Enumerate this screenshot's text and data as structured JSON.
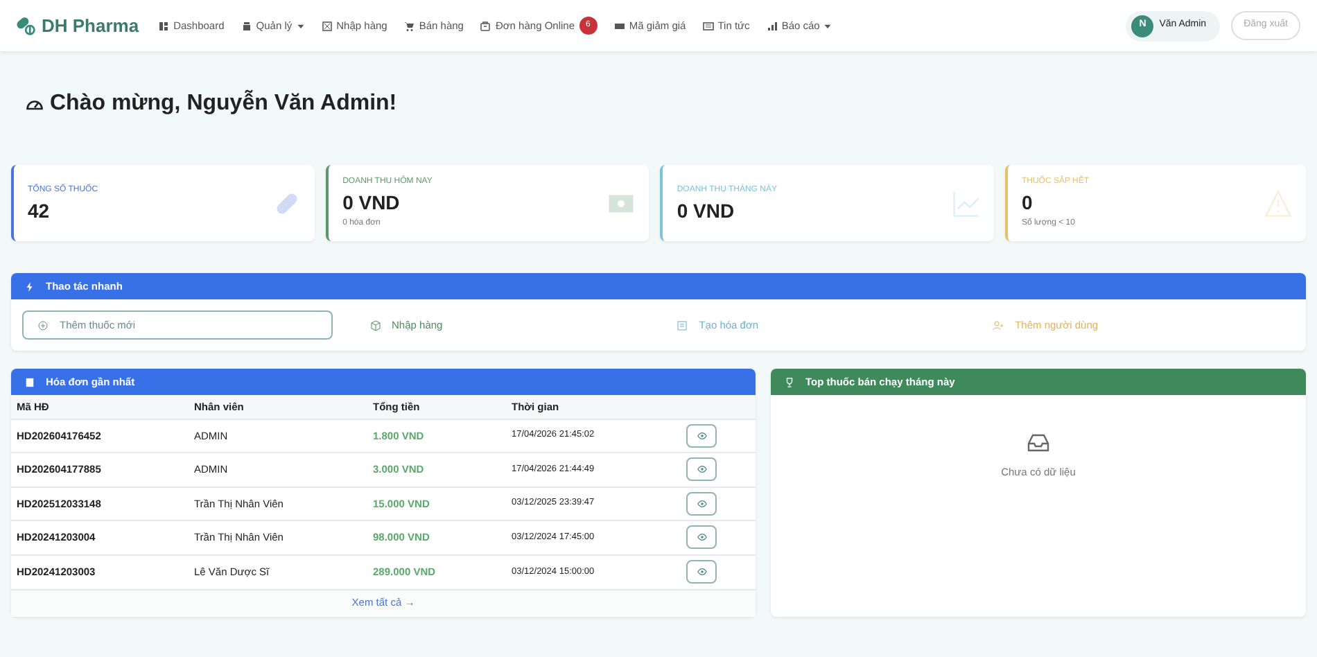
{
  "brand": "DH Pharma",
  "nav": [
    {
      "label": "Dashboard",
      "kind": "link"
    },
    {
      "label": "Quản lý",
      "kind": "dropdown"
    },
    {
      "label": "Nhập hàng",
      "kind": "link"
    },
    {
      "label": "Bán hàng",
      "kind": "link"
    },
    {
      "label": "Đơn hàng Online",
      "kind": "link",
      "badge": "6"
    },
    {
      "label": "Mã giảm giá",
      "kind": "link"
    },
    {
      "label": "Tin tức",
      "kind": "link"
    },
    {
      "label": "Báo cáo",
      "kind": "dropdown"
    }
  ],
  "user": {
    "initial": "N",
    "name": "Văn Admin",
    "logout": "Đăng xuất"
  },
  "welcome": "Chào mừng, Nguyễn Văn Admin!",
  "stats": [
    {
      "label": "TỔNG SỐ THUỐC",
      "value": "42",
      "color": "#4a74d8"
    },
    {
      "label": "DOANH THU HÔM NAY",
      "value": "0 VND",
      "note": "0 hóa đơn",
      "color": "#5a9a6a"
    },
    {
      "label": "DOANH THU THÁNG NÀY",
      "value": "0 VND",
      "color": "#7cc3dc"
    },
    {
      "label": "THUỐC SẮP HẾT",
      "value": "0",
      "note": "Số lượng < 10",
      "color": "#e8c06a"
    }
  ],
  "quick_actions": {
    "title": "Thao tác nhanh",
    "items": [
      {
        "label": "Thêm thuốc mới",
        "color": "#6b8a8a",
        "selected": true
      },
      {
        "label": "Nhập hàng",
        "color": "#4f8a5c",
        "selected": false
      },
      {
        "label": "Tạo hóa đơn",
        "color": "#6fb0cf",
        "selected": false
      },
      {
        "label": "Thêm người dùng",
        "color": "#e0b45a",
        "selected": false
      }
    ]
  },
  "recent_invoices": {
    "title": "Hóa đơn gần nhất",
    "columns": [
      "Mã HĐ",
      "Nhân viên",
      "Tổng tiền",
      "Thời gian"
    ],
    "rows": [
      [
        "HD202604176452",
        "ADMIN",
        "1.800 VND",
        "17/04/2026 21:45:02"
      ],
      [
        "HD202604177885",
        "ADMIN",
        "3.000 VND",
        "17/04/2026 21:44:49"
      ],
      [
        "HD202512033148",
        "Trần Thị Nhân Viên",
        "15.000 VND",
        "03/12/2025 23:39:47"
      ],
      [
        "HD20241203004",
        "Trần Thị Nhân Viên",
        "98.000 VND",
        "03/12/2024 17:45:00"
      ],
      [
        "HD20241203003",
        "Lê Văn Dược Sĩ",
        "289.000 VND",
        "03/12/2024 15:00:00"
      ]
    ],
    "footer_link": "Xem tất cả →"
  },
  "top_medicines": {
    "title": "Top thuốc bán chạy tháng này",
    "empty": "Chưa có dữ liệu"
  }
}
